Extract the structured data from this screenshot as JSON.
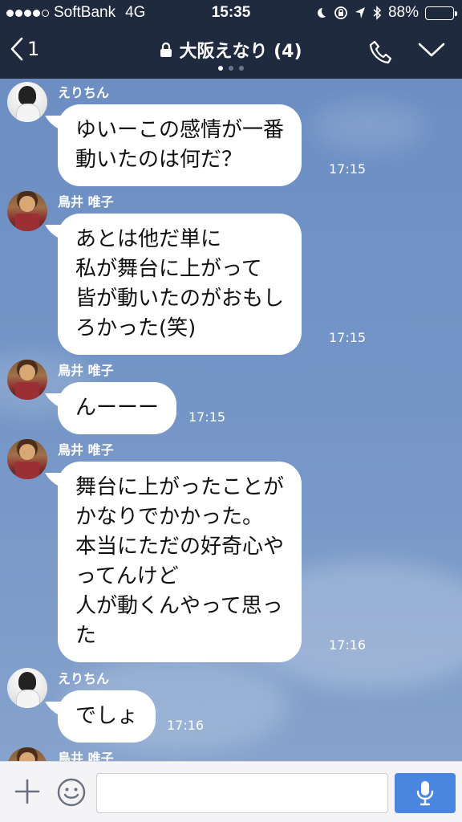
{
  "status_bar": {
    "carrier": "SoftBank",
    "network": "4G",
    "time": "15:35",
    "battery": "88%",
    "battery_level": 0.88,
    "signal_bars": 4,
    "icons": [
      "moon-icon",
      "rotation-lock-icon",
      "location-icon",
      "bluetooth-icon",
      "battery-icon"
    ]
  },
  "nav": {
    "back_count": "1",
    "title": "大阪えなり (4)",
    "icons": [
      "back-chevron-icon",
      "lock-icon",
      "phone-icon",
      "chevron-down-icon"
    ]
  },
  "messages": [
    {
      "sender": "えりちん",
      "avatar": "erichin",
      "text": "ゆいーこの感情が一番\n動いたのは何だ？",
      "time": "17:15"
    },
    {
      "sender": "鳥井 唯子",
      "avatar": "torii",
      "text": "あとは他だ単に\n私が舞台に上がって\n皆が動いたのがおもし\nろかった(笑)",
      "time": "17:15"
    },
    {
      "sender": "鳥井 唯子",
      "avatar": "torii",
      "text": "んーーー",
      "time": "17:15"
    },
    {
      "sender": "鳥井 唯子",
      "avatar": "torii",
      "text": "舞台に上がったことが\nかなりでかかった。\n本当にただの好奇心や\nってんけど\n人が動くんやって思っ\nた",
      "time": "17:16"
    },
    {
      "sender": "えりちん",
      "avatar": "erichin",
      "text": "でしょ",
      "time": "17:16"
    },
    {
      "sender": "鳥井 唯子",
      "avatar": "torii",
      "text": "",
      "time": ""
    }
  ],
  "input_bar": {
    "placeholder": "",
    "value": "",
    "icons": [
      "plus-icon",
      "emoji-icon",
      "microphone-icon"
    ]
  },
  "colors": {
    "header_bg": "#1f2a3f",
    "chat_bg": "#6f8fc0",
    "bubble_bg": "#ffffff",
    "send_button": "#4a86e0"
  }
}
